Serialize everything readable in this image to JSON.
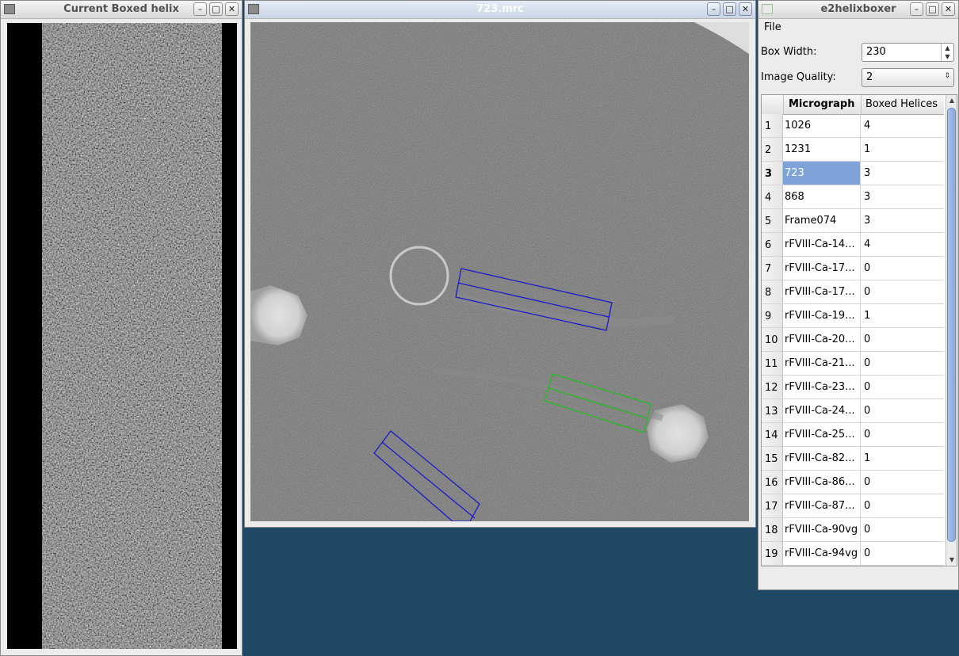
{
  "helix_window": {
    "title": "Current Boxed helix"
  },
  "micrograph_window": {
    "title": "723.mrc"
  },
  "boxer_window": {
    "title": "e2helixboxer",
    "menu": {
      "file": "File"
    },
    "box_width": {
      "label": "Box Width:",
      "value": "230"
    },
    "image_quality": {
      "label": "Image Quality:",
      "value": "2"
    },
    "table": {
      "headers": {
        "micrograph": "Micrograph",
        "boxed": "Boxed Helices"
      },
      "selected_row": 3,
      "rows": [
        {
          "num": "1",
          "micrograph": "1026",
          "boxed": "4"
        },
        {
          "num": "2",
          "micrograph": "1231",
          "boxed": "1"
        },
        {
          "num": "3",
          "micrograph": "723",
          "boxed": "3"
        },
        {
          "num": "4",
          "micrograph": "868",
          "boxed": "3"
        },
        {
          "num": "5",
          "micrograph": "Frame074",
          "boxed": "3"
        },
        {
          "num": "6",
          "micrograph": "rFVIII-Ca-14...",
          "boxed": "4"
        },
        {
          "num": "7",
          "micrograph": "rFVIII-Ca-17...",
          "boxed": "0"
        },
        {
          "num": "8",
          "micrograph": "rFVIII-Ca-17...",
          "boxed": "0"
        },
        {
          "num": "9",
          "micrograph": "rFVIII-Ca-19...",
          "boxed": "1"
        },
        {
          "num": "10",
          "micrograph": "rFVIII-Ca-20...",
          "boxed": "0"
        },
        {
          "num": "11",
          "micrograph": "rFVIII-Ca-21...",
          "boxed": "0"
        },
        {
          "num": "12",
          "micrograph": "rFVIII-Ca-23...",
          "boxed": "0"
        },
        {
          "num": "13",
          "micrograph": "rFVIII-Ca-24...",
          "boxed": "0"
        },
        {
          "num": "14",
          "micrograph": "rFVIII-Ca-25...",
          "boxed": "0"
        },
        {
          "num": "15",
          "micrograph": "rFVIII-Ca-82...",
          "boxed": "1"
        },
        {
          "num": "16",
          "micrograph": "rFVIII-Ca-86...",
          "boxed": "0"
        },
        {
          "num": "17",
          "micrograph": "rFVIII-Ca-87...",
          "boxed": "0"
        },
        {
          "num": "18",
          "micrograph": "rFVIII-Ca-90vg",
          "boxed": "0"
        },
        {
          "num": "19",
          "micrograph": "rFVIII-Ca-94vg",
          "boxed": "0"
        }
      ]
    }
  },
  "colors": {
    "desktop": "#1f4864",
    "selection": "#7fa3d8",
    "box_blue": "#1a1acc",
    "box_green": "#22bb22"
  }
}
